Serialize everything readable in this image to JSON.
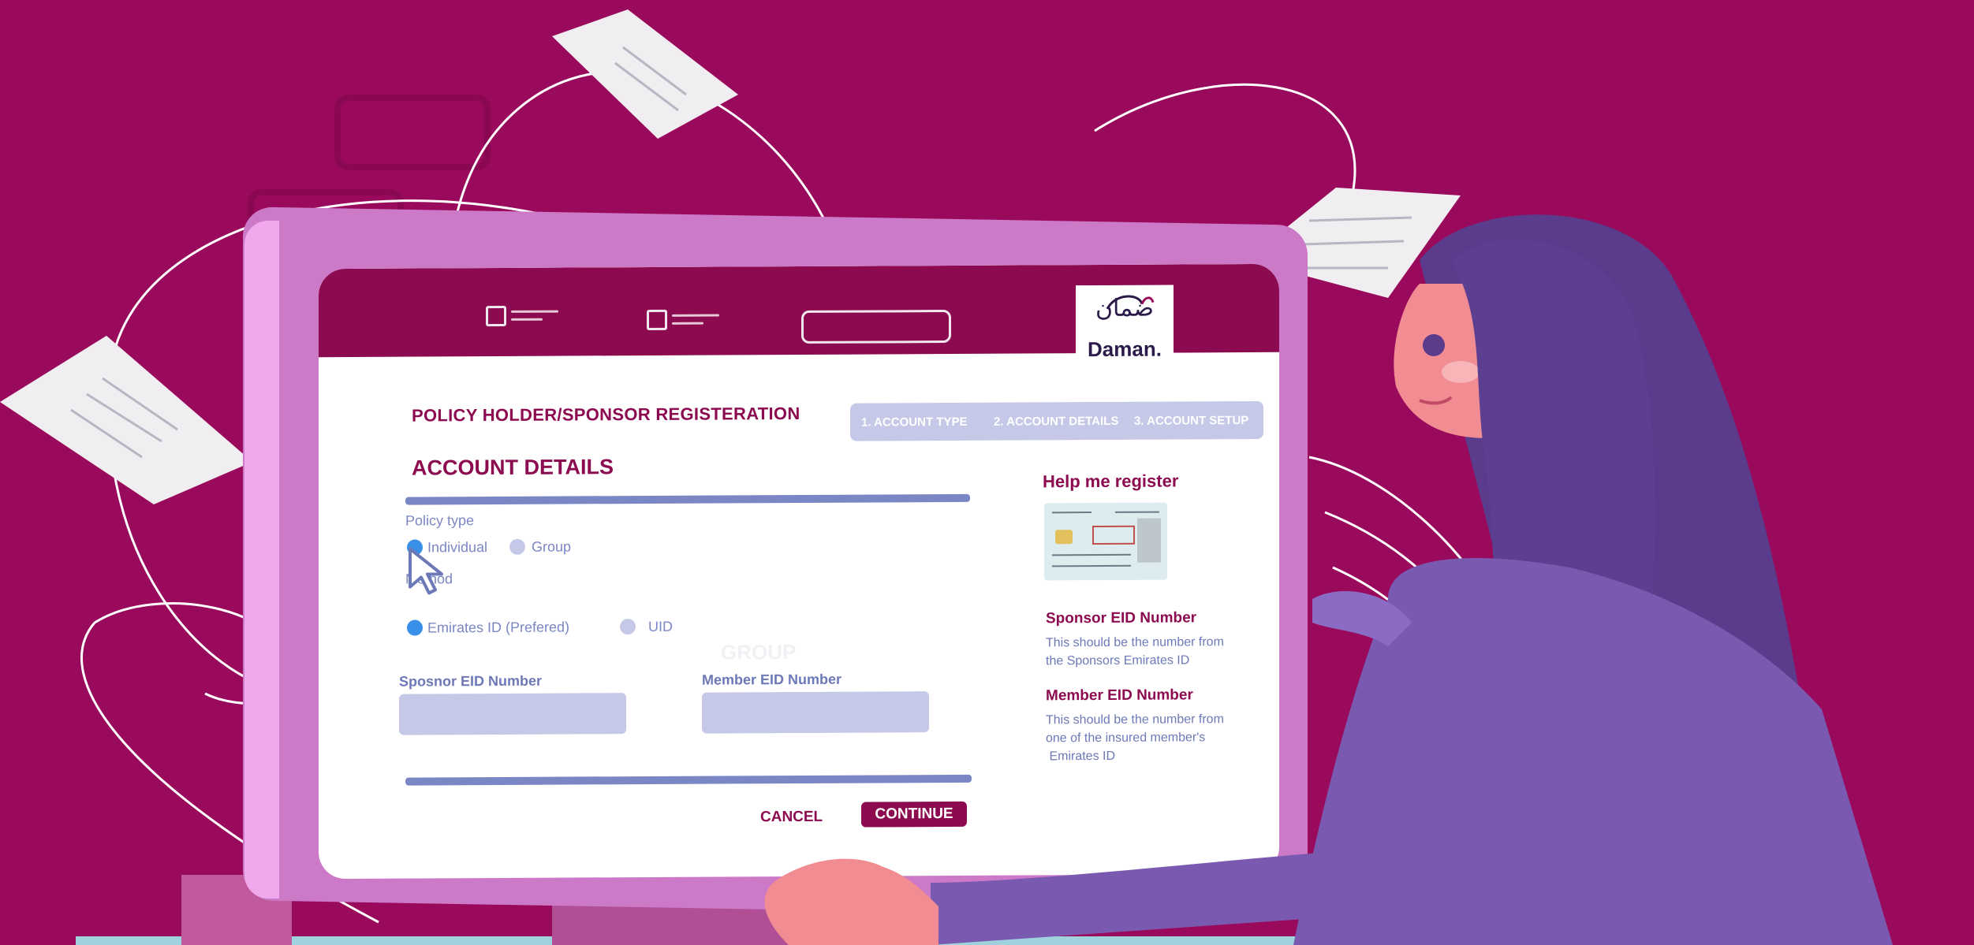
{
  "logo": {
    "arabic": "ضمان",
    "latin": "Daman."
  },
  "form": {
    "heading": "POLICY HOLDER/SPONSOR REGISTERATION",
    "steps": [
      "1. ACCOUNT TYPE",
      "2. ACCOUNT DETAILS",
      "3. ACCOUNT SETUP"
    ],
    "section_title": "ACCOUNT DETAILS",
    "policy_type_label": "Policy type",
    "policy_options": [
      "Individual",
      "Group"
    ],
    "policy_selected": "Individual",
    "method_label": "Method",
    "method_options": [
      "Emirates ID (Prefered)",
      "UID"
    ],
    "method_selected": "Emirates ID (Prefered)",
    "ghost_text": "GROUP",
    "sponsor_eid_label": "Sposnor EID Number",
    "member_eid_label": "Member EID Number",
    "sponsor_eid_value": "",
    "member_eid_value": "",
    "cancel_label": "CANCEL",
    "continue_label": "CONTINUE"
  },
  "help": {
    "title": "Help me register",
    "sponsor_title": "Sponsor EID Number",
    "sponsor_text": "This should be the number from\nthe Sponsors Emirates ID",
    "member_title": "Member EID Number",
    "member_text": "This should be the number from\none of the insured member's\n Emirates ID"
  },
  "colors": {
    "background": "#9a0a5c",
    "brand": "#8c0a4f",
    "accent": "#7b86c4",
    "field": "#c5c9e7",
    "radio_selected": "#3a8fe8"
  },
  "icons": [
    "checkbox-icon",
    "mouse-pointer-icon",
    "emirates-id-card-icon"
  ]
}
